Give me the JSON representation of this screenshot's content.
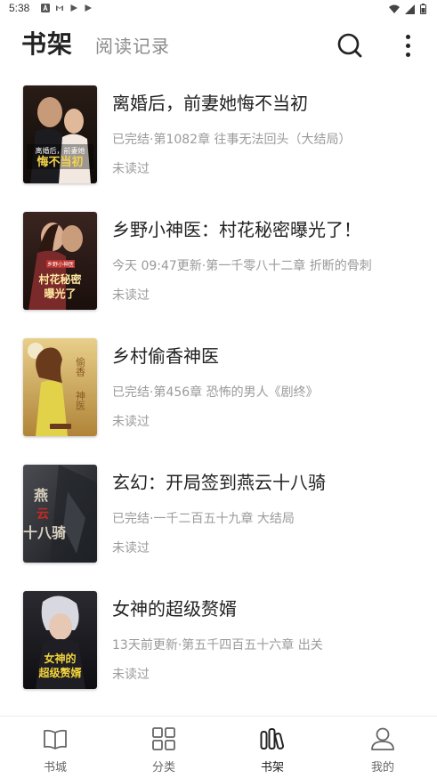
{
  "status_bar": {
    "time": "5:38",
    "notifications": [
      "a-icon",
      "gmail-icon",
      "play-icon",
      "play-icon"
    ],
    "right_icons": [
      "wifi-icon",
      "signal-icon",
      "battery-icon"
    ]
  },
  "header": {
    "active_tab": "书架",
    "inactive_tab": "阅读记录",
    "search_icon": "search-icon",
    "more_icon": "more-vertical-icon"
  },
  "books": [
    {
      "title": "离婚后，前妻她悔不当初",
      "progress": "已完结·第1082章 往事无法回头（大结局）",
      "read_status": "未读过",
      "cover_text": "悔不当初",
      "cover_colors": [
        "#1a1410",
        "#6b3a24"
      ]
    },
    {
      "title": "乡野小神医：村花秘密曝光了！",
      "progress": "今天 09:47更新·第一千零八十二章 折断的骨刺",
      "read_status": "未读过",
      "cover_text": "村花秘密曝光了",
      "cover_colors": [
        "#2a1a18",
        "#7a3626"
      ]
    },
    {
      "title": "乡村偷香神医",
      "progress": "已完结·第456章 恐怖的男人《剧终》",
      "read_status": "未读过",
      "cover_text": "偷香神医",
      "cover_colors": [
        "#d8b870",
        "#a8782c"
      ]
    },
    {
      "title": "玄幻：开局签到燕云十八骑",
      "progress": "已完结·一千二百五十九章 大结局",
      "read_status": "未读过",
      "cover_text": "燕云十八骑",
      "cover_colors": [
        "#3a3c40",
        "#1c1e22"
      ]
    },
    {
      "title": "女神的超级赘婿",
      "progress": "13天前更新·第五千四百五十六章 出关",
      "read_status": "未读过",
      "cover_text": "超级赘婿",
      "cover_colors": [
        "#1e1e22",
        "#3a3440"
      ]
    }
  ],
  "bottom_nav": [
    {
      "label": "书城",
      "icon": "book-open-icon",
      "active": false
    },
    {
      "label": "分类",
      "icon": "grid-icon",
      "active": false
    },
    {
      "label": "书架",
      "icon": "bookshelf-icon",
      "active": true
    },
    {
      "label": "我的",
      "icon": "user-icon",
      "active": false
    }
  ]
}
